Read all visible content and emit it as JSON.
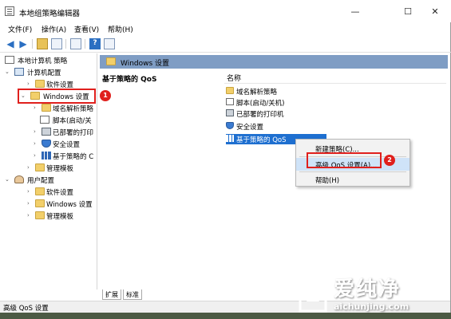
{
  "window": {
    "title": "本地组策略编辑器",
    "minimize": "—",
    "maximize": "☐",
    "close": "✕"
  },
  "menu": [
    "文件(F)",
    "操作(A)",
    "查看(V)",
    "帮助(H)"
  ],
  "tree": {
    "root": "本地计算机 策略",
    "computer_config": "计算机配置",
    "software_settings": "软件设置",
    "windows_settings": "Windows 设置",
    "dns": "域名解析策略",
    "scripts": "脚本(启动/关",
    "printers": "已部署的打印",
    "security": "安全设置",
    "qos": "基于策略的 C",
    "admin_templates": "管理模板",
    "user_config": "用户配置",
    "user_software": "软件设置",
    "user_windows": "Windows 设置",
    "user_admin": "管理模板"
  },
  "pane": {
    "header": "Windows 设置",
    "section_title": "基于策略的 QoS",
    "column_name": "名称",
    "items": [
      "域名解析策略",
      "脚本(启动/关机)",
      "已部署的打印机",
      "安全设置",
      "基于策略的 QoS"
    ]
  },
  "context_menu": {
    "new_policy": "新建策略(C)...",
    "advanced_qos": "高级 QoS 设置(A)...",
    "help": "帮助(H)"
  },
  "badges": {
    "one": "1",
    "two": "2"
  },
  "tabs": {
    "extended": "扩展",
    "standard": "标准"
  },
  "status": "高级 QoS 设置",
  "watermark": {
    "brand": "爱纯净",
    "url": "aichunjing.com"
  },
  "colors": {
    "selection": "#1e6fd0",
    "header": "#7f9dc4",
    "highlight_red": "#e0201d"
  }
}
